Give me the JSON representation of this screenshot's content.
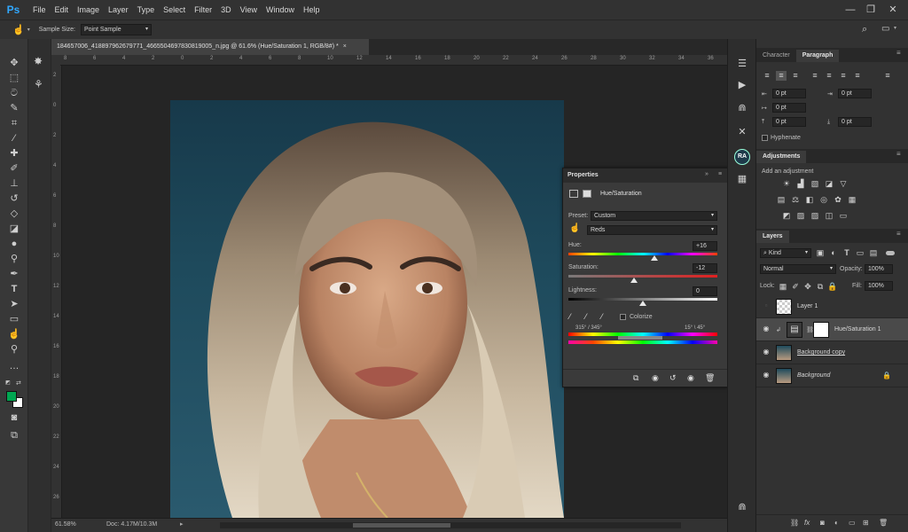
{
  "app": {
    "logo": "Ps",
    "menus": [
      "File",
      "Edit",
      "Image",
      "Layer",
      "Type",
      "Select",
      "Filter",
      "3D",
      "View",
      "Window",
      "Help"
    ],
    "window_controls": {
      "minimize": "—",
      "restore": "❐",
      "close": "✕"
    }
  },
  "options_bar": {
    "sample_size_label": "Sample Size:",
    "sample_size_value": "Point Sample"
  },
  "document": {
    "tab_title": "184657006_418897962679771_4665504697830819005_n.jpg @ 61.6% (Hue/Saturation 1, RGB/8#) *",
    "close": "×",
    "zoom": "61.58%",
    "doc_size": "Doc: 4.17M/10.3M",
    "ruler_top_labels": [
      "8",
      "6",
      "4",
      "2",
      "0",
      "2",
      "4",
      "6",
      "8",
      "10",
      "12",
      "14",
      "16",
      "18",
      "20",
      "22",
      "24",
      "26",
      "28",
      "30",
      "32",
      "34",
      "36"
    ],
    "ruler_left_labels": [
      "2",
      "0",
      "2",
      "4",
      "6",
      "8",
      "10",
      "12",
      "14",
      "16",
      "18",
      "20",
      "22",
      "24",
      "26"
    ]
  },
  "properties": {
    "title": "Properties",
    "header": "Hue/Saturation",
    "preset_label": "Preset:",
    "preset_value": "Custom",
    "channel_value": "Reds",
    "hue_label": "Hue:",
    "hue_value": "+16",
    "saturation_label": "Saturation:",
    "saturation_value": "-12",
    "lightness_label": "Lightness:",
    "lightness_value": "0",
    "colorize_label": "Colorize",
    "range_left": "315° / 345°",
    "range_right": "15° \\ 45°",
    "hue_pos": 0.58,
    "sat_pos": 0.44,
    "light_pos": 0.5
  },
  "character_panel": {
    "tab_character": "Character",
    "tab_paragraph": "Paragraph",
    "indent_left": "0 pt",
    "indent_right": "0 pt",
    "indent_first": "0 pt",
    "space_before": "0 pt",
    "space_after": "0 pt",
    "hyphenate_label": "Hyphenate"
  },
  "adjustments_panel": {
    "title": "Adjustments",
    "subtitle": "Add an adjustment"
  },
  "layers_panel": {
    "title": "Layers",
    "filter_value": "Kind",
    "blend_mode": "Normal",
    "opacity_label": "Opacity:",
    "opacity_value": "100%",
    "lock_label": "Lock:",
    "fill_label": "Fill:",
    "fill_value": "100%",
    "layers": [
      {
        "name": "Layer 1",
        "visible": false
      },
      {
        "name": "Hue/Saturation 1",
        "visible": true
      },
      {
        "name": "Background copy",
        "visible": true
      },
      {
        "name": "Background",
        "visible": true
      }
    ]
  },
  "right_strip": {
    "avatar_initials": "RA"
  },
  "colors": {
    "foreground": "#00a651",
    "background": "#ffffff",
    "accent": "#31a8ff"
  }
}
